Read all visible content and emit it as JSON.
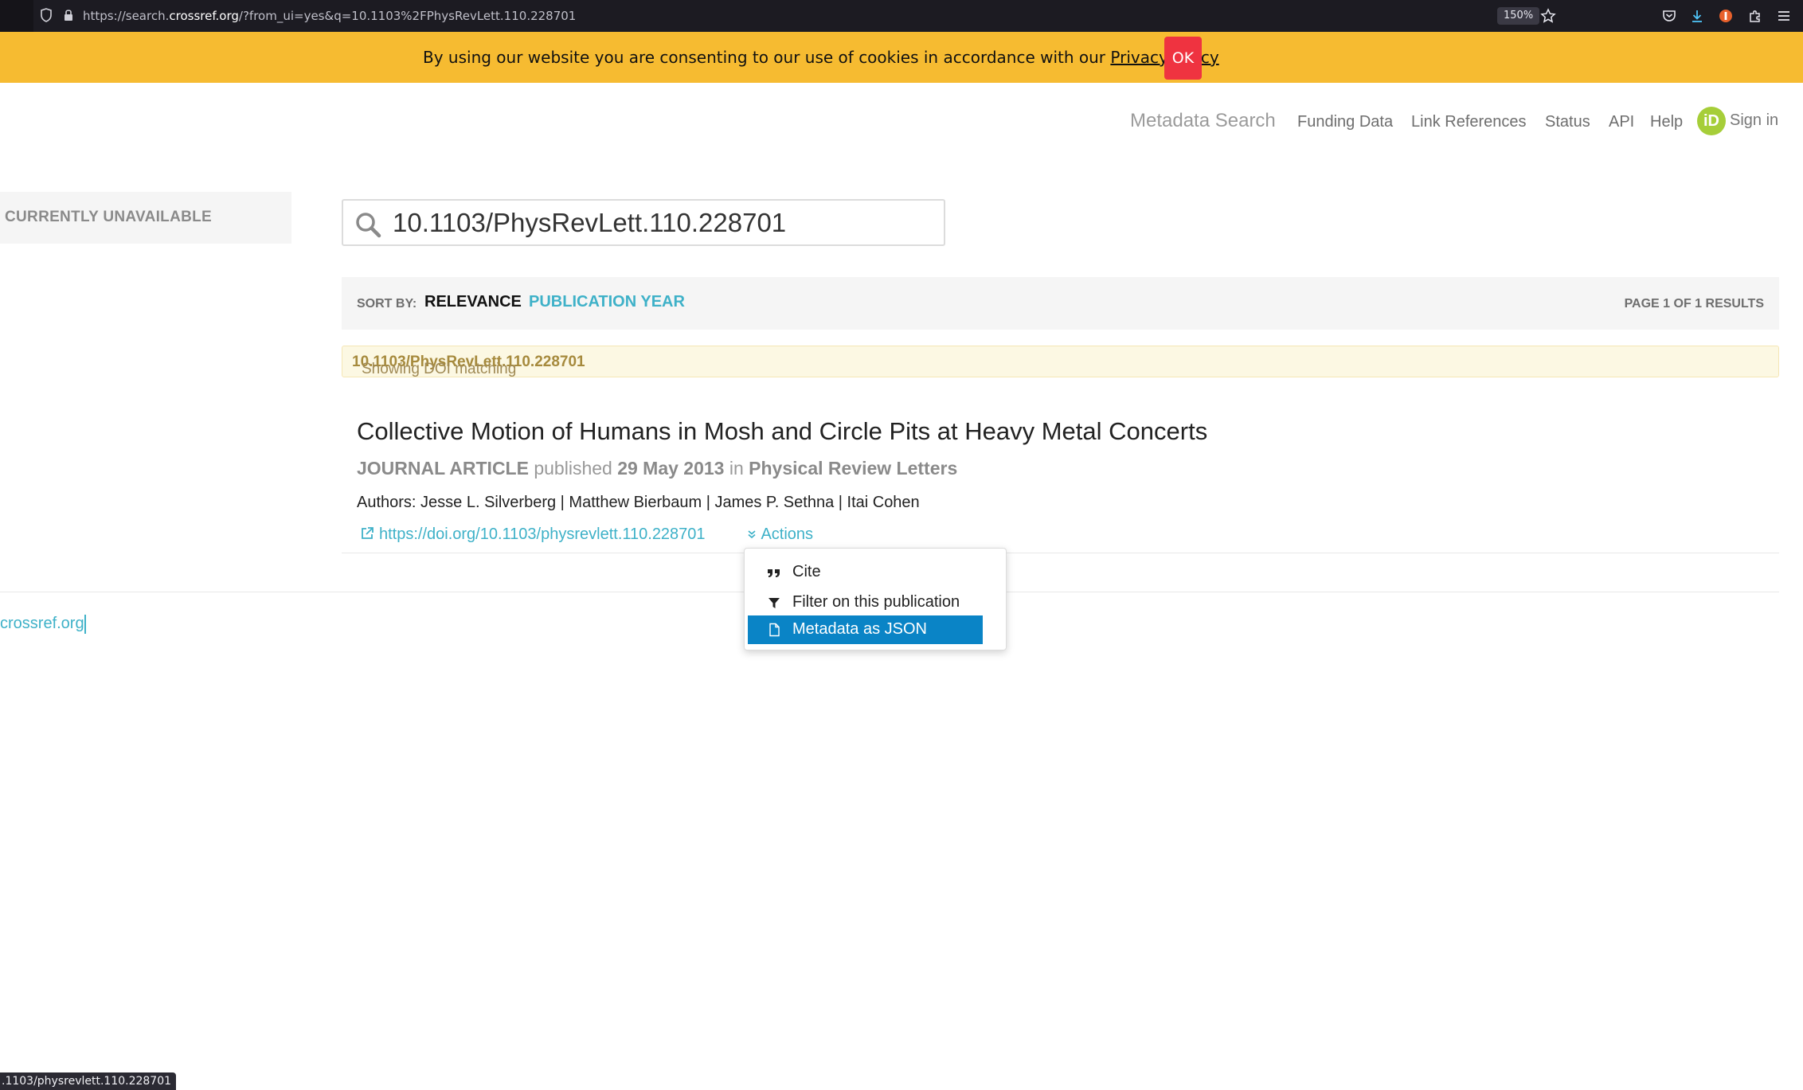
{
  "browser": {
    "url_prefix": "https://search.",
    "url_host": "crossref.org",
    "url_rest": "/?from_ui=yes&q=10.1103%2FPhysRevLett.110.228701",
    "zoom": "150%"
  },
  "cookie_banner": {
    "text": "By using our website you are consenting to our use of cookies in accordance with our ",
    "link": "Privacy Policy",
    "ok_label": "OK"
  },
  "nav": {
    "active": "Metadata Search",
    "items": [
      "Funding Data",
      "Link References",
      "Status",
      "API",
      "Help"
    ],
    "orcid": "iD",
    "sign_in": "Sign in"
  },
  "side_panel": {
    "label": "CURRENTLY UNAVAILABLE"
  },
  "search": {
    "value": "10.1103/PhysRevLett.110.228701"
  },
  "sort": {
    "label": "SORT BY:",
    "relevance": "RELEVANCE",
    "year": "PUBLICATION YEAR",
    "page_info": "PAGE 1 OF 1 RESULTS"
  },
  "notice": {
    "prefix": "Showing DOI matching ",
    "doi": "10.1103/PhysRevLett.110.228701"
  },
  "result": {
    "title": "Collective Motion of Humans in Mosh and Circle Pits at Heavy Metal Concerts",
    "type": "JOURNAL ARTICLE",
    "published_word": "published",
    "date": "29 May 2013",
    "in_word": "in",
    "journal": "Physical Review Letters",
    "authors": "Authors: Jesse L. Silverberg | Matthew Bierbaum | James P. Sethna | Itai Cohen",
    "doi_link": "https://doi.org/10.1103/physrevlett.110.228701",
    "actions": "Actions"
  },
  "actions_menu": {
    "items": [
      "Cite",
      "Filter on this publication",
      "Metadata as JSON"
    ],
    "selected": "Metadata as JSON"
  },
  "footer": {
    "link": "crossref.org"
  },
  "status_bar": {
    "text": ".1103/physrevlett.110.228701"
  },
  "colors": {
    "cookie_banner": "#f6bb31",
    "ok_button": "#ef3340",
    "link": "#3eb1c8",
    "menu_selected": "#0a84c6",
    "orcid": "#a6ce39"
  }
}
